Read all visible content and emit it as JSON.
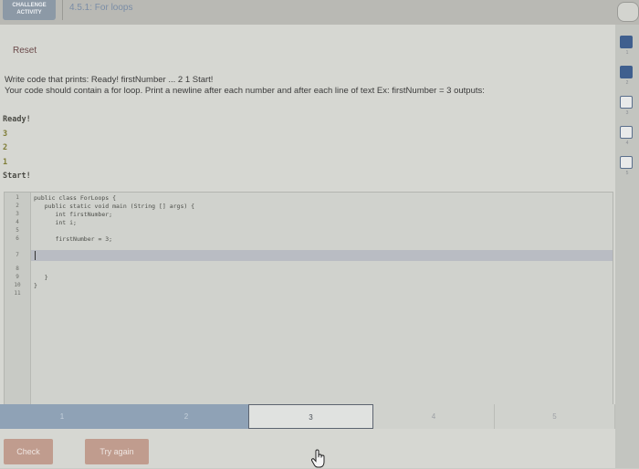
{
  "header": {
    "badge_line1": "CHALLENGE",
    "badge_line2": "ACTIVITY",
    "title": "4.5.1: For loops"
  },
  "toolbar": {
    "reset_label": "Reset"
  },
  "prompt": {
    "line1": "Write code that prints: Ready! firstNumber ... 2 1 Start!",
    "line2": "Your code should contain a for loop. Print a newline after each number and after each line of text Ex: firstNumber = 3 outputs:"
  },
  "sample_output": {
    "line1": "Ready!",
    "line2": "3",
    "line3": "2",
    "line4": "1",
    "line5": "Start!"
  },
  "editor": {
    "line_numbers": [
      "1",
      "2",
      "3",
      "4",
      "5",
      "6",
      "7",
      "8",
      "9",
      "10",
      "11"
    ],
    "lines": [
      "public class ForLoops {",
      "   public static void main (String [] args) {",
      "      int firstNumber;",
      "      int i;",
      "",
      "      firstNumber = 3;",
      "",
      "",
      "   }",
      "}",
      ""
    ]
  },
  "progress": {
    "segments": [
      "1",
      "2",
      "3",
      "4",
      "5"
    ],
    "active_index": 2
  },
  "buttons": {
    "check_label": "Check",
    "try_again_label": "Try again"
  },
  "sidebar": {
    "numbers": [
      "1",
      "2",
      "3",
      "4",
      "5"
    ]
  },
  "colors": {
    "accent": "#3f5f8e",
    "button": "#c09c8e",
    "progress_done": "#8fa2b6"
  }
}
